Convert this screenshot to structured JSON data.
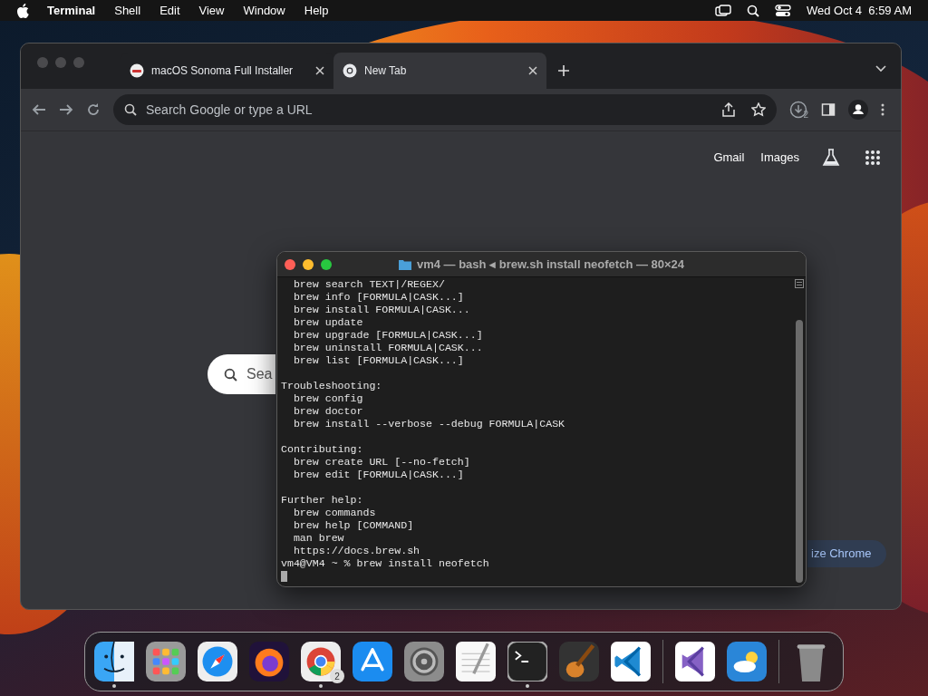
{
  "menu_bar": {
    "app_name": "Terminal",
    "items": [
      "Shell",
      "Edit",
      "View",
      "Window",
      "Help"
    ],
    "clock": "Wed Oct 4  6:59 AM"
  },
  "browser": {
    "tabs": [
      {
        "title": "macOS Sonoma Full Installer",
        "kind": "site",
        "selected": false
      },
      {
        "title": "New Tab",
        "kind": "chrome",
        "selected": true
      }
    ],
    "address_placeholder": "Search Google or type a URL",
    "download_count": "2",
    "top_links": [
      "Gmail",
      "Images"
    ],
    "search_placeholder": "Sea",
    "customize_button": "ize Chrome"
  },
  "terminal": {
    "title": "vm4 — bash ◂ brew.sh install neofetch — 80×24",
    "blocks": [
      [
        "  brew search TEXT|/REGEX/",
        "  brew info [FORMULA|CASK...]",
        "  brew install FORMULA|CASK...",
        "  brew update",
        "  brew upgrade [FORMULA|CASK...]",
        "  brew uninstall FORMULA|CASK...",
        "  brew list [FORMULA|CASK...]"
      ],
      [
        "Troubleshooting:",
        "  brew config",
        "  brew doctor",
        "  brew install --verbose --debug FORMULA|CASK"
      ],
      [
        "Contributing:",
        "  brew create URL [--no-fetch]",
        "  brew edit [FORMULA|CASK...]"
      ],
      [
        "Further help:",
        "  brew commands",
        "  brew help [COMMAND]",
        "  man brew",
        "  https://docs.brew.sh"
      ]
    ],
    "prompt": "vm4@VM4 ~ % brew install neofetch"
  },
  "dock": [
    {
      "kind": "finder",
      "running": true
    },
    {
      "kind": "launchpad",
      "running": false
    },
    {
      "kind": "safari",
      "running": false
    },
    {
      "kind": "firefox",
      "running": false
    },
    {
      "kind": "chrome",
      "running": true,
      "badge": "2"
    },
    {
      "kind": "appstore",
      "running": false
    },
    {
      "kind": "settings",
      "running": false
    },
    {
      "kind": "textedit",
      "running": false
    },
    {
      "kind": "terminal",
      "running": true
    },
    {
      "kind": "garageband",
      "running": false
    },
    {
      "kind": "vscode",
      "running": false
    },
    {
      "kind": "separator"
    },
    {
      "kind": "visualstudio",
      "running": false
    },
    {
      "kind": "weather",
      "running": false
    },
    {
      "kind": "separator"
    },
    {
      "kind": "trash",
      "running": false
    }
  ]
}
